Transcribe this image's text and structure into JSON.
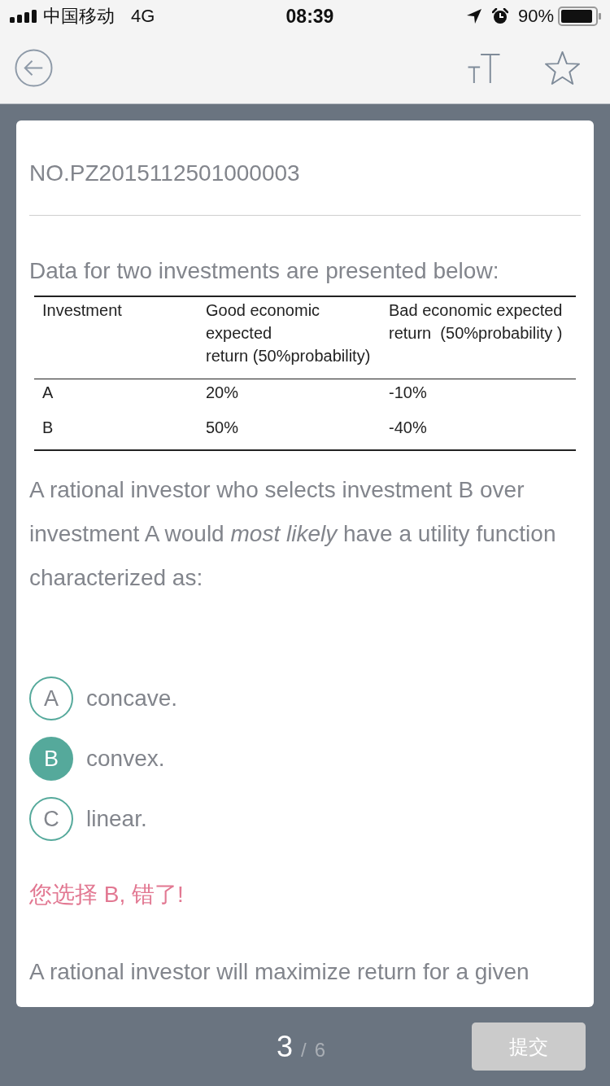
{
  "status_bar": {
    "carrier": "中国移动",
    "network": "4G",
    "time": "08:39",
    "battery": "90%"
  },
  "question": {
    "number": "NO.PZ2015112501000003",
    "intro": "Data for two investments are presented below:",
    "table": {
      "columns": [
        "Investment",
        "Good economic\nexpected\nreturn (50%probability)",
        "Bad economic expected\nreturn  (50%probability )"
      ],
      "rows": [
        [
          "A",
          "20%",
          "-10%"
        ],
        [
          "B",
          "50%",
          "-40%"
        ]
      ]
    },
    "stem": "A rational investor who selects investment B over investment A would *most likely* have a utility function characterized as:",
    "options": [
      {
        "letter": "A",
        "text": "concave.",
        "selected": false
      },
      {
        "letter": "B",
        "text": "convex.",
        "selected": true
      },
      {
        "letter": "C",
        "text": "linear.",
        "selected": false
      }
    ],
    "feedback": "您选择 B, 错了!",
    "explanation": "A rational investor will maximize return for a given"
  },
  "footer": {
    "current": "3",
    "separator": "/",
    "total": "6",
    "submit": "提交"
  }
}
